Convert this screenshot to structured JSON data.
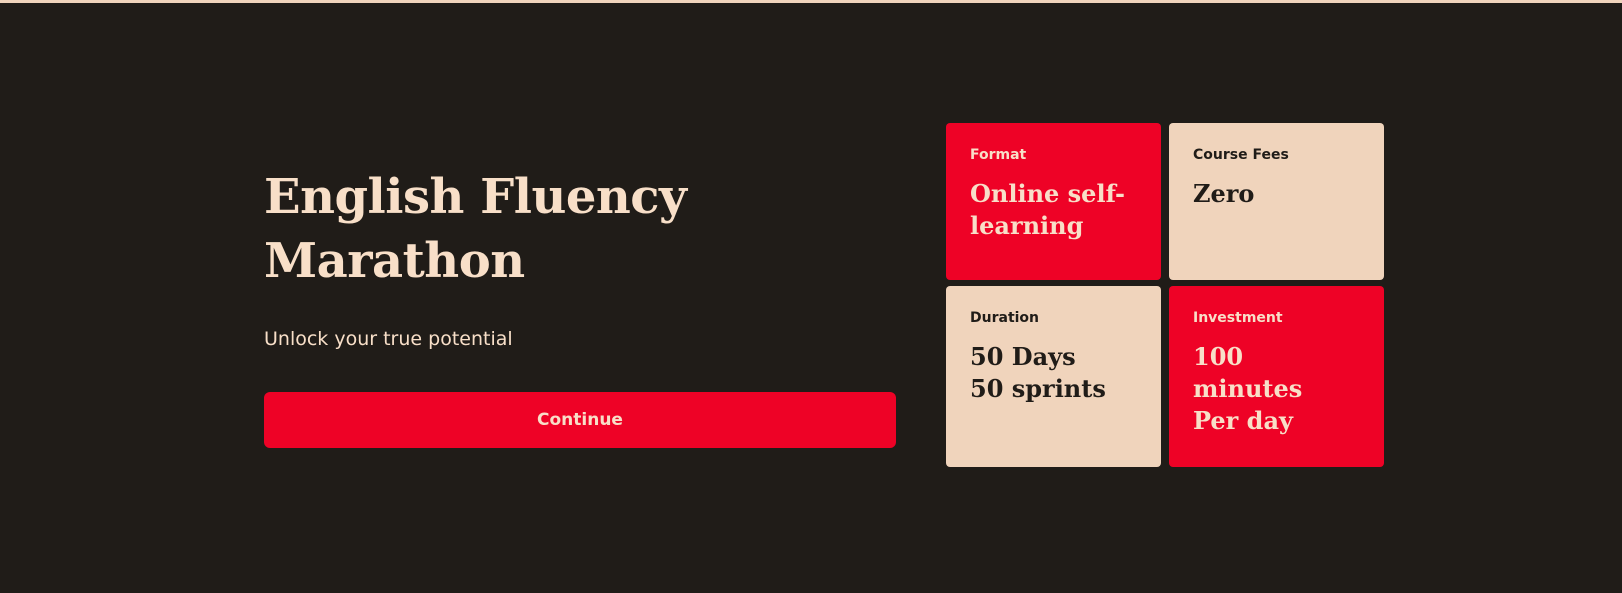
{
  "hero": {
    "title_line1": "English Fluency",
    "title_line2": "Marathon",
    "subtitle": "Unlock your true potential",
    "continue_label": "Continue"
  },
  "cards": {
    "format": {
      "label": "Format",
      "value_line1": "Online self-",
      "value_line2": "learning"
    },
    "fees": {
      "label": "Course Fees",
      "value": "Zero"
    },
    "duration": {
      "label": "Duration",
      "value_line1": "50 Days",
      "value_line2": "50 sprints"
    },
    "investment": {
      "label": "Investment",
      "value_line1": "100 minutes",
      "value_line2": "Per day"
    }
  },
  "colors": {
    "background": "#201c18",
    "accent_red": "#ee0226",
    "cream": "#f0d4bc",
    "text_light": "#f8dfc8"
  }
}
